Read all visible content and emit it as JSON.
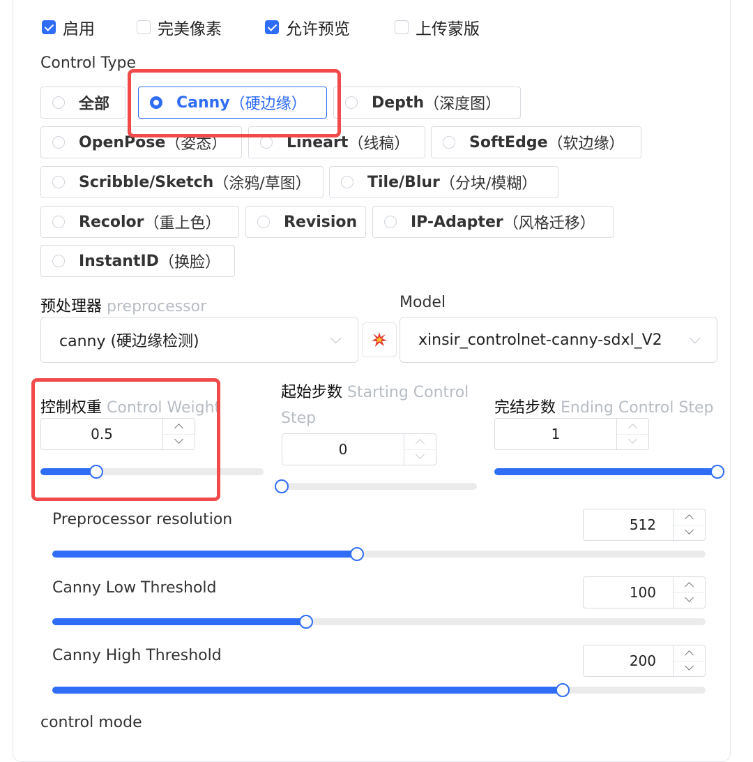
{
  "checkboxes": [
    {
      "label": "启用",
      "checked": true
    },
    {
      "label": "完美像素",
      "checked": false
    },
    {
      "label": "允许预览",
      "checked": true
    },
    {
      "label": "上传蒙版",
      "checked": false
    }
  ],
  "control_type": {
    "label": "Control Type",
    "options": [
      {
        "name": "全部",
        "paren": ""
      },
      {
        "name": "Canny",
        "paren": "（硬边缘）",
        "selected": true
      },
      {
        "name": "Depth",
        "paren": "（深度图）"
      },
      {
        "name": "OpenPose",
        "paren": "（姿态）"
      },
      {
        "name": "Lineart",
        "paren": "（线稿）"
      },
      {
        "name": "SoftEdge",
        "paren": "（软边缘）"
      },
      {
        "name": "Scribble/Sketch",
        "paren": "（涂鸦/草图）"
      },
      {
        "name": "Tile/Blur",
        "paren": "（分块/模糊）"
      },
      {
        "name": "Recolor",
        "paren": "（重上色）"
      },
      {
        "name": "Revision",
        "paren": ""
      },
      {
        "name": "IP-Adapter",
        "paren": "（风格迁移）"
      },
      {
        "name": "InstantID",
        "paren": "（换脸）"
      }
    ]
  },
  "preprocessor": {
    "label": "预处理器",
    "sublabel": "preprocessor",
    "value": "canny (硬边缘检测)"
  },
  "model": {
    "label": "Model",
    "value": "xinsir_controlnet-canny-sdxl_V2"
  },
  "run_icon": "explosion-icon",
  "weights": {
    "control_weight": {
      "label": "控制权重",
      "sublabel": "Control Weight",
      "value": "0.5",
      "fraction": 0.25
    },
    "starting_step": {
      "label": "起始步数",
      "sublabel_line1": "Starting Control",
      "sublabel_line2": "Step",
      "value": "0",
      "fraction": 0.0
    },
    "ending_step": {
      "label": "完结步数",
      "sublabel": "Ending Control Step",
      "value": "1",
      "fraction": 1.0
    }
  },
  "params": [
    {
      "label": "Preprocessor resolution",
      "value": "512",
      "fraction": 0.466
    },
    {
      "label": "Canny Low Threshold",
      "value": "100",
      "fraction": 0.389
    },
    {
      "label": "Canny High Threshold",
      "value": "200",
      "fraction": 0.781
    }
  ],
  "control_mode_label": "control mode",
  "colors": {
    "accent": "#2f6df6",
    "highlight": "#f04a4a"
  }
}
